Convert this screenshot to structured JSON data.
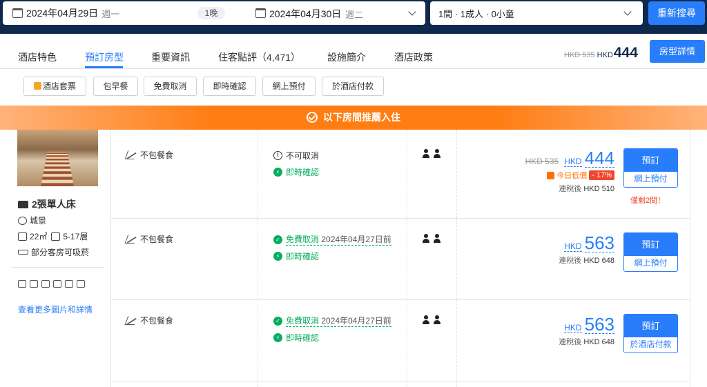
{
  "search": {
    "checkin_date": "2024年04月29日",
    "checkin_weekday": "週一",
    "nights": "1晚",
    "checkout_date": "2024年04月30日",
    "checkout_weekday": "週二",
    "guests": "1間 · 1成人 · 0小童",
    "research_label": "重新搜尋"
  },
  "tabs": [
    {
      "label": "酒店特色"
    },
    {
      "label": "預訂房型"
    },
    {
      "label": "重要資訊"
    },
    {
      "label": "住客點評（4,471）"
    },
    {
      "label": "設施簡介"
    },
    {
      "label": "酒店政策"
    }
  ],
  "header_price": {
    "original": "HKD 535",
    "currency": "HKD",
    "price": "444",
    "room_detail_label": "房型詳情"
  },
  "filters": [
    "酒店套票",
    "包早餐",
    "免費取消",
    "即時確認",
    "網上預付",
    "於酒店付款"
  ],
  "recommend_text": "以下房間推薦入住",
  "room": {
    "bed": "2張單人床",
    "view": "城景",
    "size": "22㎡",
    "floor": "5-17層",
    "smoking": "部分客房可吸菸",
    "more_link": "查看更多圖片和詳情"
  },
  "rates": [
    {
      "meal": "不包餐食",
      "policy1": "不可取消",
      "policy1_date": "",
      "policy2": "即時確認",
      "original": "HKD 535",
      "currency": "HKD",
      "price": "444",
      "lowest_label": "今日低價",
      "discount": "- 17%",
      "tax_label": "連稅後",
      "tax_price": "HKD 510",
      "book_label": "預訂",
      "pay_label": "網上預付",
      "left": "僅剩2間！"
    },
    {
      "meal": "不包餐食",
      "policy1": "免費取消",
      "policy1_date": "2024年04月27日前",
      "policy2": "即時確認",
      "currency": "HKD",
      "price": "563",
      "tax_label": "連稅後",
      "tax_price": "HKD 648",
      "book_label": "預訂",
      "pay_label": "網上預付"
    },
    {
      "meal": "不包餐食",
      "policy1": "免費取消",
      "policy1_date": "2024年04月27日前",
      "policy2": "即時確認",
      "currency": "HKD",
      "price": "563",
      "tax_label": "連稅後",
      "tax_price": "HKD 648",
      "book_label": "預訂",
      "pay_label": "於酒店付款"
    }
  ],
  "colors": {
    "primary": "#287dfa",
    "navy": "#0f294d",
    "orange": "#ff7d13",
    "green": "#06ae5f",
    "red": "#f0462d"
  }
}
